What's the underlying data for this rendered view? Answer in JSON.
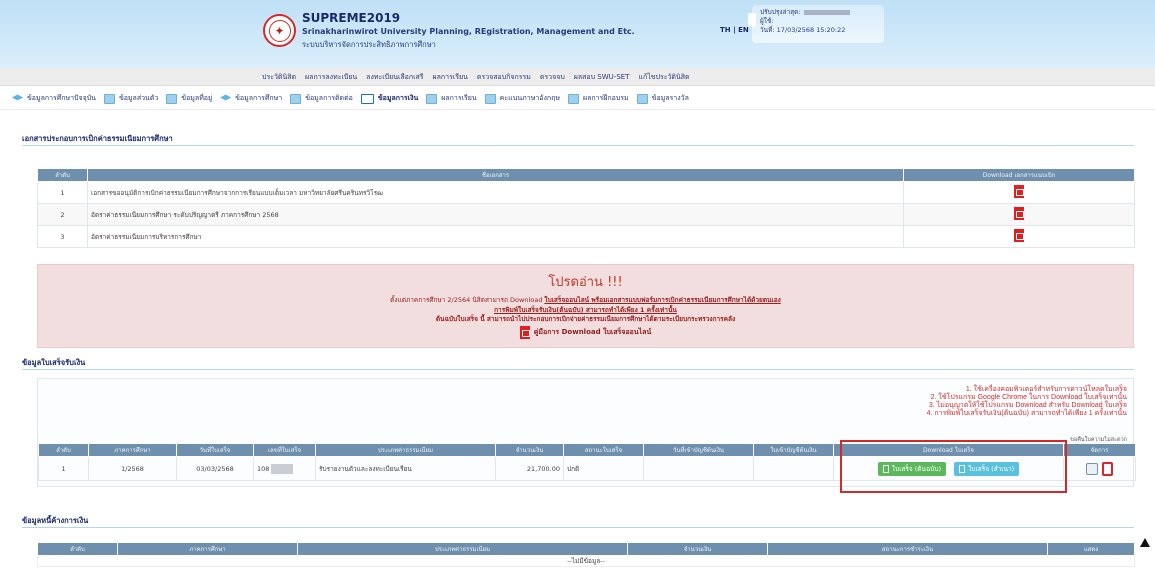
{
  "header": {
    "brand_title": "SUPREME2019",
    "brand_subtitle": "Srinakharinwirot University Planning, REgistration, Management and Etc.",
    "brand_thai": "ระบบบริหารจัดการประสิทธิภาพการศึกษา",
    "lang_th": "TH",
    "lang_sep": "|",
    "lang_en": "EN",
    "user_line1_label": "ปรับปรุงล่าสุด:",
    "user_line2_label": "ผู้ใช้:",
    "user_line3": "วันที่: 17/03/2568 15:20:22"
  },
  "top_menu": [
    "ประวัตินิสิต",
    "ผลการลงทะเบียน",
    "ลงทะเบียนเลือกเสรี",
    "ผลการเรียน",
    "ตรวจสอบกิจกรรม",
    "ตรวจจบ",
    "ผลสอบ SWU-SET",
    "แก้ไขประวัตินิสิต"
  ],
  "tabs": [
    {
      "label": "ข้อมูลการศึกษาปัจจุบัน",
      "icon": "graduation-cap-icon"
    },
    {
      "label": "ข้อมูลส่วนตัว",
      "icon": "document-icon"
    },
    {
      "label": "ข้อมูลที่อยู่",
      "icon": "document-icon"
    },
    {
      "label": "ข้อมูลการศึกษา",
      "icon": "graduation-cap-icon"
    },
    {
      "label": "ข้อมูลการติดต่อ",
      "icon": "document-icon"
    },
    {
      "label": "ข้อมูลการเงิน",
      "icon": "money-icon"
    },
    {
      "label": "ผลการเรียน",
      "icon": "document-icon"
    },
    {
      "label": "คะแนนภาษาอังกฤษ",
      "icon": "document-icon"
    },
    {
      "label": "ผลการฝึกอบรม",
      "icon": "document-icon"
    },
    {
      "label": "ข้อมูลรางวัล",
      "icon": "document-icon"
    }
  ],
  "docs_section": {
    "title": "เอกสารประกอบการเบิกค่าธรรมเนียมการศึกษา",
    "headers": [
      "ลำดับ",
      "ชื่อเอกสาร",
      "Download เอกสารแนบเบิก"
    ],
    "rows": [
      {
        "no": "1",
        "name": "เอกสารขออนุมัติการเบิกค่าธรรมเนียมการศึกษาจากการเรียนแบบเต็มเวลา มหาวิทยาลัยศรีนครินทรวิโรฒ"
      },
      {
        "no": "2",
        "name": "อัตราค่าธรรมเนียมการศึกษา ระดับปริญญาตรี ภาคการศึกษา 2568"
      },
      {
        "no": "3",
        "name": "อัตราค่าธรรมเนียมการบริหารการศึกษา"
      }
    ]
  },
  "notice": {
    "title": "โปรดอ่าน !!!",
    "line1a": "ตั้งแต่ภาคการศึกษา 2/2564 นิสิตสามารถ Download ",
    "line1b": "ใบเสร็จออนไลน์ พร้อมเอกสารแบบฟอร์มการเบิกค่าธรรมเนียมการศึกษาได้ด้วยตนเอง",
    "line2": "การพิมพ์ใบเสร็จรับเงิน(ต้นฉบับ) สามารถทำได้เพียง 1 ครั้งเท่านั้น",
    "line3": "ต้นฉบับใบเสร็จ นี้ สามารถนำไปประกอบการเบิกจ่ายค่าธรรมเนียมการศึกษาได้ตามระเบียบกระทรวงการคลัง",
    "manual": "คู่มือการ Download ใบเสร็จออนไลน์"
  },
  "receipts_section": {
    "title": "ข้อมูลใบเสร็จรับเงิน",
    "rules": [
      "1. ใช้เครื่องคอมพิวเตอร์สำหรับการดาวน์โหลดใบเสร็จ",
      "2. ใช้โปรแกรม Google Chrome ในการ Download ใบเสร็จเท่านั้น",
      "3. ไม่อนุญาตให้ใช้โปรแกรม Download สำหรับ Download ใบเสร็จ",
      "4. การพิมพ์ใบเสร็จรับเงิน(ต้นฉบับ) สามารถทำได้เพียง 1 ครั้งเท่านั้น"
    ],
    "tiny_note": "ขอคืนใบความไม่สะดวก",
    "headers": [
      "ลำดับ",
      "ภาคการศึกษา",
      "วันที่ใบเสร็จ",
      "เลขที่ใบเสร็จ",
      "ประเภทค่าธรรมเนียม",
      "จำนวนเงิน",
      "สถานะใบเสร็จ",
      "วันที่เข้าบัญชีต้นเงิน",
      "ใบเข้าบัญชีต้นเงิน",
      "Download ใบเสร็จ",
      "จัดการ"
    ],
    "rows": [
      {
        "no": "1",
        "term": "1/2568",
        "date": "03/03/2568",
        "receipt_no": "108",
        "fee_type": "รับรายงานตัวและลงทะเบียนเรียน",
        "amount": "21,700.00",
        "status": "ปกติ",
        "date_in": "",
        "account": ""
      }
    ],
    "btn_original": "ใบเสร็จ (ต้นฉบับ)",
    "btn_copy": "ใบเสร็จ (สำเนา)"
  },
  "debts_section": {
    "title": "ข้อมูลหนี้ค้างการเงิน",
    "headers": [
      "ลำดับ",
      "ภาคการศึกษา",
      "ประเภทค่าธรรมเนียม",
      "จำนวนเงิน",
      "สถานะการชำระเงิน",
      "แสดง"
    ],
    "empty": "--ไม่มีข้อมูล--"
  }
}
